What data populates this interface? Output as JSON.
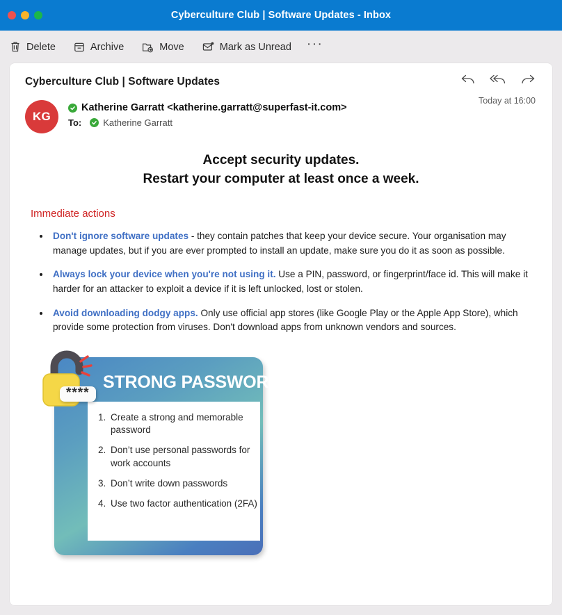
{
  "window": {
    "title": "Cyberculture Club | Software Updates  - Inbox",
    "controls": {
      "close": "close-button",
      "minimize": "minimize-button",
      "maximize": "maximize-button"
    },
    "accent_color": "#0a7bd0"
  },
  "toolbar": {
    "delete_label": "Delete",
    "archive_label": "Archive",
    "move_label": "Move",
    "mark_unread_label": "Mark as Unread",
    "more_label": "···"
  },
  "email": {
    "subject": "Cyberculture Club | Software Updates",
    "avatar_initials": "KG",
    "avatar_color": "#d93a3a",
    "sender": "Katherine Garratt <katherine.garratt@superfast-it.com>",
    "to_label": "To:",
    "to_recipient": "Katherine Garratt",
    "timestamp": "Today at 16:00",
    "actions": {
      "reply": "reply-button",
      "reply_all": "reply-all-button",
      "forward": "forward-button"
    }
  },
  "body": {
    "banner_line_1": "Accept security updates.",
    "banner_line_2": "Restart your computer at least once a week.",
    "section_title": "Immediate actions",
    "section_title_color": "#cf2222",
    "link_color": "#3f6fc4",
    "bullets": [
      {
        "lead": "Don't ignore software updates",
        "rest": " - they contain patches that keep your device secure. Your organisation may manage updates, but if you are ever prompted to install an update, make sure you do it as soon as possible."
      },
      {
        "lead": "Always lock your device when you're not using it.",
        "rest": " Use a PIN, password, or fingerprint/face id. This will make it harder for an attacker to exploit a device if it is left unlocked, lost or stolen."
      },
      {
        "lead": "Avoid downloading dodgy apps.",
        "rest": " Only use official app stores (like Google Play or the Apple App Store), which provide some protection from viruses. Don't download apps from unknown vendors and sources."
      }
    ]
  },
  "password_graphic": {
    "title": "STRONG PASSWORDS",
    "badge_text": "****",
    "tips": [
      "Create a strong and memorable password",
      "Don’t use personal passwords for work accounts",
      "Don’t write down passwords",
      "Use two factor authentication (2FA)"
    ]
  }
}
